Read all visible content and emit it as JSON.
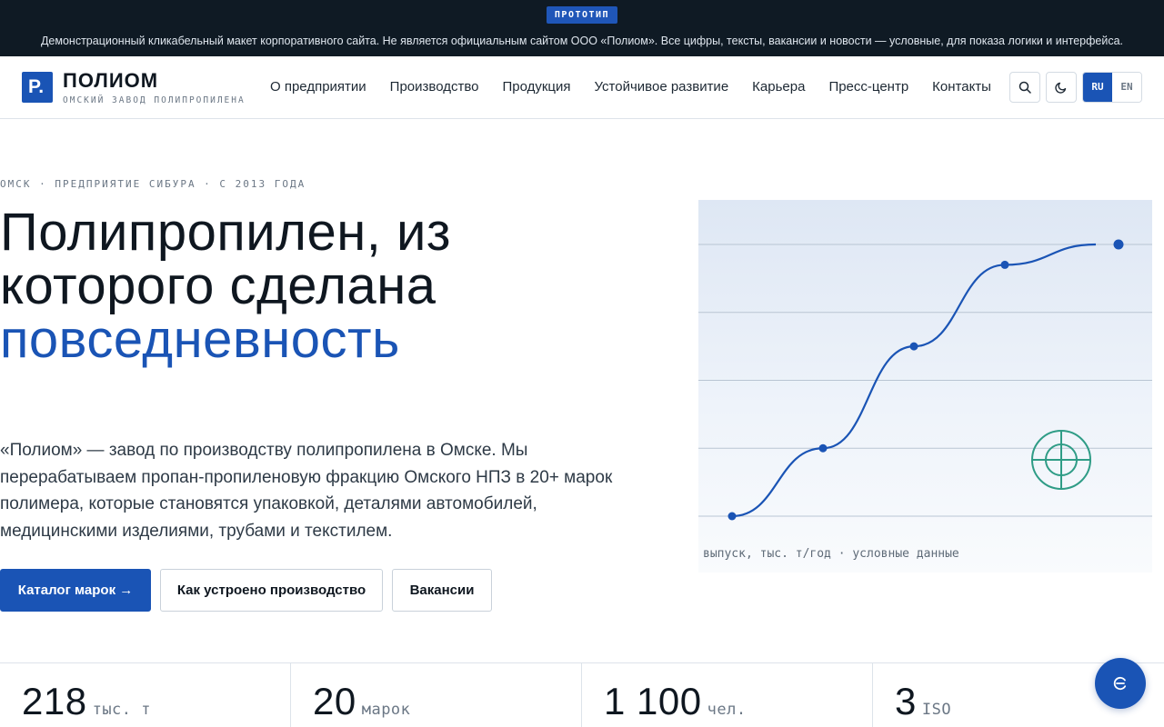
{
  "banner": {
    "badge": "ПРОТОТИП",
    "text": "Демонстрационный кликабельный макет корпоративного сайта. Не является официальным сайтом ООО «Полиом». Все цифры, тексты, вакансии и новости — условные, для показа логики и интерфейса."
  },
  "header": {
    "logo_mark": "P.",
    "logo_name": "ПОЛИОМ",
    "logo_sub": "ОМСКИЙ ЗАВОД ПОЛИПРОПИЛЕНА",
    "nav": [
      {
        "label": "О предприятии"
      },
      {
        "label": "Производство"
      },
      {
        "label": "Продукция"
      },
      {
        "label": "Устойчивое развитие"
      },
      {
        "label": "Карьера"
      },
      {
        "label": "Пресс-центр"
      },
      {
        "label": "Контакты"
      }
    ],
    "icons": [
      "search-icon",
      "moon-icon"
    ],
    "lang": {
      "active": "RU",
      "inactive": "EN"
    }
  },
  "hero": {
    "eyebrow": "ОМСК · ПРЕДПРИЯТИЕ СИБУРА · С 2013 ГОДА",
    "title_main": "Полипропилен, из которого сделана",
    "title_accent": "повседневность",
    "lead": "«Полиом» — завод по производству полипропилена в Омске. Мы перерабатываем пропан-пропиленовую фракцию Омского НПЗ в 20+ марок полимера, которые становятся упаковкой, деталями автомобилей, медицинскими изделиями, трубами и текстилем.",
    "buttons": {
      "primary": "Каталог марок →",
      "secondary1": "Как устроено производство",
      "secondary2": "Вакансии"
    }
  },
  "chart_data": {
    "type": "line",
    "caption": "выпуск, тыс. т/год · условные данные",
    "values": [
      0,
      1,
      2.5,
      3.7,
      4.0
    ],
    "ylim": [
      0,
      4
    ],
    "grid": true,
    "colors": {
      "line": "#1a54b5",
      "grid": "#b9c5d3",
      "target": "#2f9c86"
    },
    "icon": "target-icon"
  },
  "stats": [
    {
      "value": "218",
      "unit": "тыс. т"
    },
    {
      "value": "20",
      "unit": "марок"
    },
    {
      "value": "1 100",
      "unit": "чел."
    },
    {
      "value": "3",
      "unit": "ISO"
    }
  ],
  "fab": {
    "icon": "chat-icon"
  },
  "colors": {
    "accent": "#1a54b5",
    "dark": "#0f1a24"
  }
}
